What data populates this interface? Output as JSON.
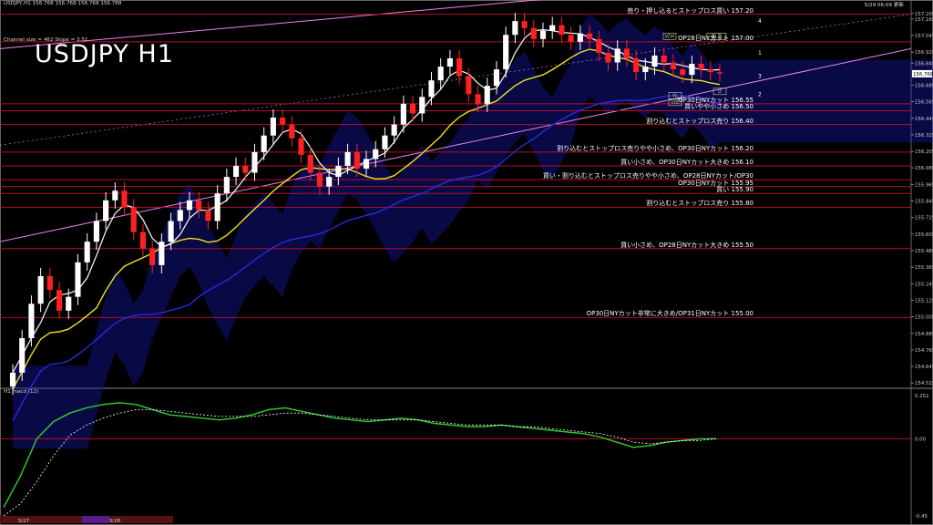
{
  "header": {
    "left": "USDJPY,H1  156.768 156.768 156.768 156.768",
    "right": "5/29 06:09 更新"
  },
  "title": "USDJPY H1",
  "channel_info": "Channel size = 462  Slope = 3.51",
  "oscillator_label": "H1  macd (12)",
  "colors": {
    "background": "#000000",
    "bull_candle": "#ffffff",
    "bear_candle": "#ff2020",
    "level_line": "#b0102a",
    "channel_line": "#ee82ee",
    "ma_fast": "#ffffff",
    "ma_slow": "#f0e020",
    "ma_long": "#2a2adc",
    "cloud": "#1a1ac8",
    "osc_line": "#30d030",
    "osc_signal": "#ffffff"
  },
  "chart_data": [
    {
      "type": "candlestick",
      "symbol": "USDJPY",
      "timeframe": "H1",
      "last_price": 156.768,
      "y_axis_ticks": [
        "157.205",
        "157.165",
        "157.045",
        "156.925",
        "156.845",
        "156.685",
        "156.565",
        "156.445",
        "156.325",
        "156.205",
        "156.085",
        "155.965",
        "155.845",
        "155.725",
        "155.605",
        "155.485",
        "155.365",
        "155.245",
        "155.125",
        "155.005",
        "154.885",
        "154.765",
        "154.645",
        "154.525"
      ],
      "ylim": [
        154.5,
        157.25
      ],
      "levels": [
        {
          "price": 157.2,
          "label": "売り・押し込るとストップロス買い 157.20"
        },
        {
          "price": 157.0,
          "label": "OP28日NYカット 157.00"
        },
        {
          "price": 156.55,
          "label": "OP30日NYカット 156.55"
        },
        {
          "price": 156.5,
          "label": "買いやや小さめ 156.50"
        },
        {
          "price": 156.4,
          "label": "割り込むとストップロス売り 156.40"
        },
        {
          "price": 156.2,
          "label": "割り込むとストップロス売りやや小さめ、OP30日NYカット 156.20"
        },
        {
          "price": 156.1,
          "label": "買い小さめ、OP30日NYカット大きめ 156.10"
        },
        {
          "price": 156.0,
          "label": "買い・割り込むとストップロス売りやや小さめ、OP28日NYカット/OP30"
        },
        {
          "price": 155.95,
          "label": "OP30日NYカット 155.95"
        },
        {
          "price": 155.9,
          "label": "買い 155.90"
        },
        {
          "price": 155.8,
          "label": "割り込むとストップロス売り 155.80"
        },
        {
          "price": 155.5,
          "label": "買い小さめ、OP28日NYカット大きめ 155.50"
        },
        {
          "price": 155.0,
          "label": "OP30日NYカット非常に大きめ/OP31日NYカット 155.00"
        }
      ],
      "channel_marks": [
        "4",
        "1",
        "3",
        "2"
      ],
      "box_labels": [
        "VDH",
        "VH",
        "VL",
        "VDL",
        "D",
        "D"
      ],
      "x_labels": [
        "5/27",
        "5/28"
      ],
      "closes": [
        154.6,
        154.85,
        155.1,
        155.3,
        155.2,
        155.05,
        155.15,
        155.4,
        155.55,
        155.7,
        155.85,
        155.92,
        155.8,
        155.62,
        155.5,
        155.38,
        155.55,
        155.7,
        155.78,
        155.85,
        155.78,
        155.7,
        155.9,
        156.02,
        156.1,
        156.05,
        156.2,
        156.32,
        156.45,
        156.4,
        156.3,
        156.18,
        156.05,
        155.95,
        156.02,
        156.1,
        156.2,
        156.08,
        156.15,
        156.22,
        156.32,
        156.4,
        156.55,
        156.48,
        156.6,
        156.72,
        156.82,
        156.88,
        156.75,
        156.62,
        156.55,
        156.68,
        156.8,
        157.05,
        157.15,
        157.1,
        157.02,
        157.08,
        157.12,
        157.05,
        157.0,
        157.06,
        157.02,
        156.92,
        156.85,
        156.95,
        156.88,
        156.78,
        156.82,
        156.9,
        156.85,
        156.8,
        156.76,
        156.84,
        156.8,
        156.78,
        156.77
      ]
    },
    {
      "type": "line",
      "title": "H1  macd (12)",
      "ylim": [
        -0.45,
        0.252
      ],
      "y_axis_ticks": [
        "0.252",
        "0.00",
        "-0.45"
      ],
      "series": [
        {
          "values": [
            -0.4,
            -0.22,
            0.0,
            0.1,
            0.15,
            0.18,
            0.2,
            0.21,
            0.2,
            0.17,
            0.14,
            0.13,
            0.12,
            0.11,
            0.12,
            0.14,
            0.17,
            0.18,
            0.16,
            0.14,
            0.12,
            0.11,
            0.1,
            0.11,
            0.12,
            0.11,
            0.09,
            0.08,
            0.07,
            0.07,
            0.08,
            0.07,
            0.06,
            0.05,
            0.04,
            0.03,
            0.01,
            -0.02,
            -0.05,
            -0.04,
            -0.02,
            -0.01,
            0.0,
            0.0
          ]
        },
        {
          "values": [
            -0.45,
            -0.38,
            -0.25,
            -0.1,
            0.02,
            0.08,
            0.12,
            0.15,
            0.17,
            0.17,
            0.16,
            0.15,
            0.14,
            0.13,
            0.13,
            0.13,
            0.14,
            0.15,
            0.15,
            0.14,
            0.13,
            0.12,
            0.11,
            0.11,
            0.11,
            0.11,
            0.1,
            0.09,
            0.08,
            0.08,
            0.08,
            0.07,
            0.07,
            0.06,
            0.05,
            0.04,
            0.03,
            0.01,
            -0.02,
            -0.03,
            -0.02,
            -0.01,
            -0.01,
            0.0
          ]
        }
      ]
    }
  ]
}
